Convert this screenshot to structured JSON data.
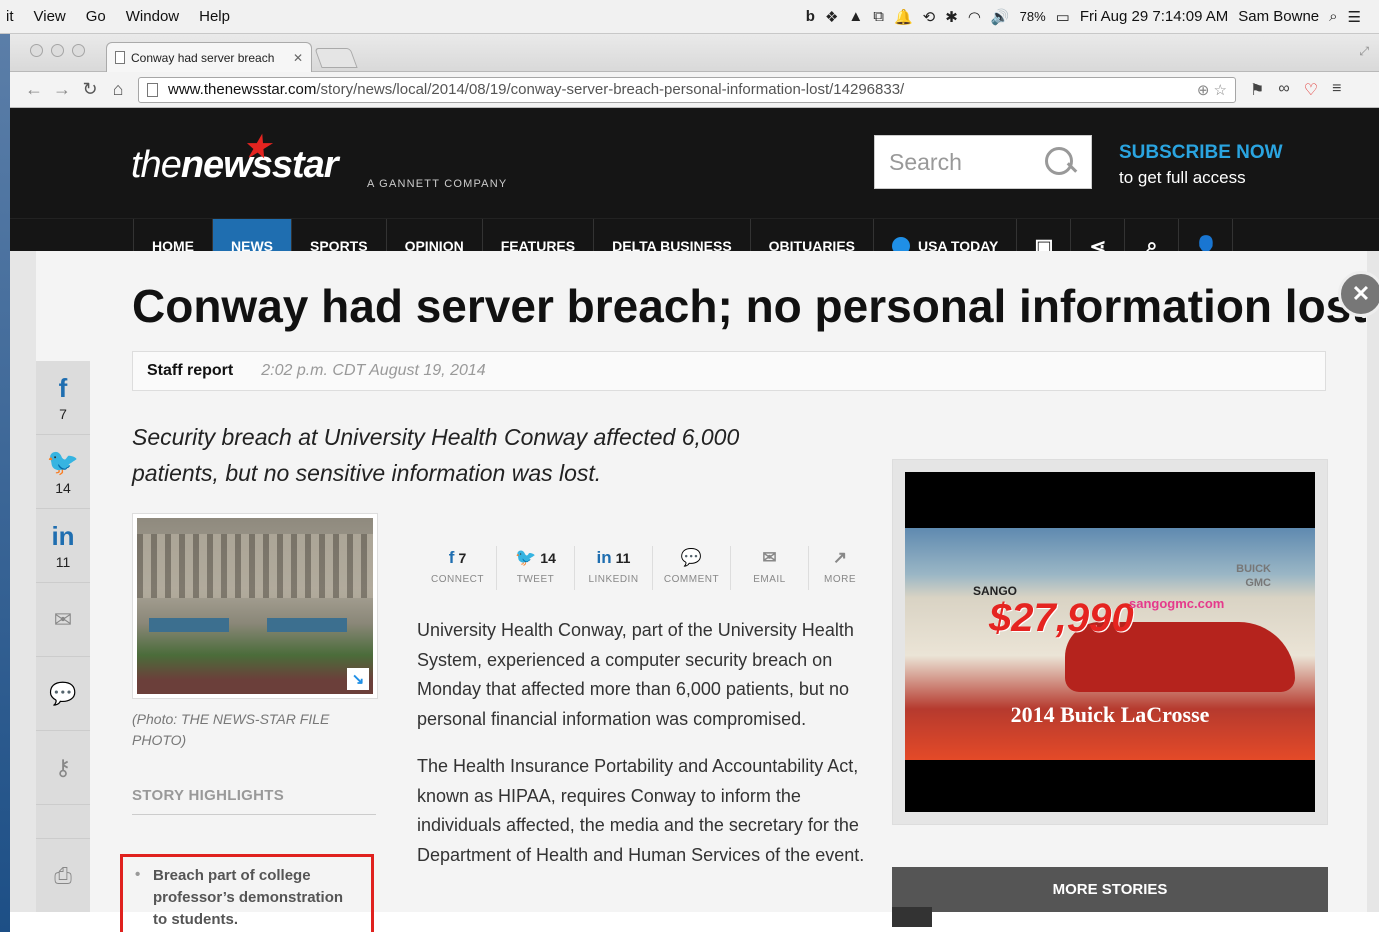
{
  "menubar": {
    "items": [
      "it",
      "View",
      "Go",
      "Window",
      "Help"
    ],
    "battery": "78%",
    "datetime": "Fri Aug 29  7:14:09 AM",
    "user": "Sam Bowne"
  },
  "browser": {
    "tab_title": "Conway had server breach",
    "url_domain": "www.thenewsstar.com",
    "url_path": "/story/news/local/2014/08/19/conway-server-breach-personal-information-lost/14296833/"
  },
  "site": {
    "logo_the": "the",
    "logo_news": "news",
    "logo_star": "star",
    "gannett": "A GANNETT COMPANY",
    "search_placeholder": "Search",
    "subscribe_now": "SUBSCRIBE NOW",
    "subscribe_sub": "to get full access",
    "nav": [
      "HOME",
      "NEWS",
      "SPORTS",
      "OPINION",
      "FEATURES",
      "DELTA BUSINESS",
      "OBITUARIES",
      "USA TODAY"
    ]
  },
  "rail": {
    "facebook_count": "7",
    "twitter_count": "14",
    "linkedin_count": "11"
  },
  "article": {
    "headline": "Conway had server breach; no personal information lost",
    "byline": "Staff report",
    "timestamp": "2:02 p.m. CDT August 19, 2014",
    "summary": "Security breach at University Health Conway affected 6,000 patients, but no sensitive information was lost.",
    "photo_caption": "(Photo: THE NEWS-STAR FILE PHOTO)",
    "highlights_title": "STORY HIGHLIGHTS",
    "highlight_1": "Breach part of college professor’s demonstration to students.",
    "paragraph_1": "University Health Conway, part of the University Health System, experienced a computer security breach on Monday that affected more than 6,000 patients, but no personal financial information was compromised.",
    "paragraph_2": "The Health Insurance Portability and Accountability Act, known as HIPAA, requires Conway to inform the individuals affected, the media and the secretary for the Department of Health and Human Services of the event."
  },
  "share": [
    {
      "icon": "f",
      "count": "7",
      "label": "CONNECT"
    },
    {
      "icon": "🐦",
      "count": "14",
      "label": "TWEET"
    },
    {
      "icon": "in",
      "count": "11",
      "label": "LINKEDIN"
    },
    {
      "icon": "💬",
      "count": "",
      "label": "COMMENT"
    },
    {
      "icon": "✉",
      "count": "",
      "label": "EMAIL"
    },
    {
      "icon": "↗",
      "count": "",
      "label": "MORE"
    }
  ],
  "ad": {
    "dealer": "SANGO",
    "brand": "BUICK\nGMC",
    "price": "$27,990",
    "url": "sangogmc.com",
    "model": "2014 Buick LaCrosse"
  },
  "sidebar": {
    "more_stories": "MORE STORIES"
  }
}
